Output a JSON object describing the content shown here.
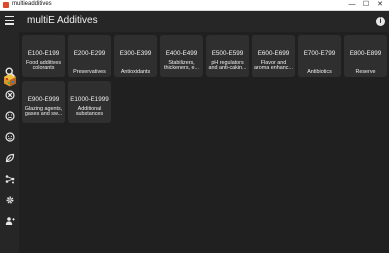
{
  "window": {
    "title": "multieadditives",
    "controls": [
      "—",
      "☐",
      "✕"
    ]
  },
  "header": {
    "title": "multiE Additives",
    "info_label": "i"
  },
  "sidebar": {
    "items": [
      {
        "name": "search",
        "icon": "search-icon"
      },
      {
        "name": "x-circle",
        "icon": "x-circle-icon"
      },
      {
        "name": "sad-face",
        "icon": "sad-face-icon"
      },
      {
        "name": "baby-face",
        "icon": "baby-face-icon"
      },
      {
        "name": "leaf",
        "icon": "leaf-icon"
      },
      {
        "name": "share",
        "icon": "share-icon"
      },
      {
        "name": "settings",
        "icon": "gear-icon"
      },
      {
        "name": "user-add",
        "icon": "person-add-icon"
      }
    ]
  },
  "categories": [
    {
      "code": "E100-E199",
      "desc1": "Food additives",
      "desc2": "colorants"
    },
    {
      "code": "E200-E299",
      "desc1": "Preservatives",
      "desc2": ""
    },
    {
      "code": "E300-E399",
      "desc1": "Antioxidants",
      "desc2": ""
    },
    {
      "code": "E400-E499",
      "desc1": "Stabilizers,",
      "desc2": "thickeners, e..."
    },
    {
      "code": "E500-E599",
      "desc1": "pH regulators",
      "desc2": "and anti-cakin..."
    },
    {
      "code": "E600-E699",
      "desc1": "Flavor and",
      "desc2": "aroma enhanc..."
    },
    {
      "code": "E700-E799",
      "desc1": "Antibiotics",
      "desc2": ""
    },
    {
      "code": "E800-E899",
      "desc1": "Reserve",
      "desc2": ""
    },
    {
      "code": "E900-E999",
      "desc1": "Glazing agents,",
      "desc2": "gases and sw..."
    },
    {
      "code": "E1000-E1999",
      "desc1": "Additional",
      "desc2": "substances"
    }
  ],
  "colors": {
    "background": "#202020",
    "panel": "#262626",
    "tile": "#2f2f2f",
    "text": "#f0f0f0"
  }
}
